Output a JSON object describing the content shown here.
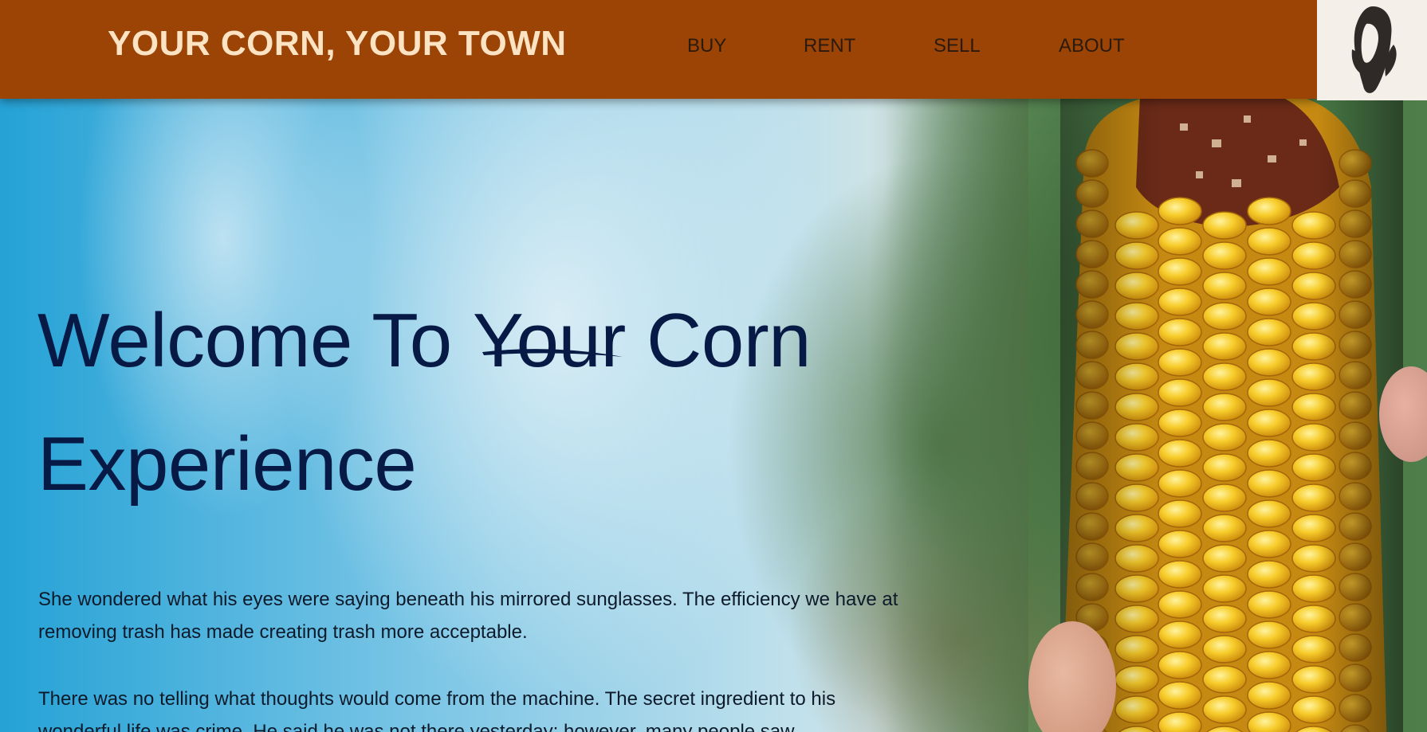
{
  "header": {
    "brand": "YOUR CORN, YOUR TOWN",
    "nav": [
      "BUY",
      "RENT",
      "SELL",
      "ABOUT"
    ],
    "logo_icon": "corn-logo-icon"
  },
  "hero": {
    "headline_pre": "Welcome To ",
    "headline_emph": "Your",
    "headline_post": " Corn Experience",
    "paragraphs": [
      "She wondered what his eyes were saying beneath his mirrored sunglasses. The efficiency we have at removing trash has made creating trash more acceptable.",
      "There was no telling what thoughts would come from the machine. The secret ingredient to his wonderful life was crime. He said he was not there yesterday; however, many people saw"
    ]
  },
  "colors": {
    "header_bg": "#9b4405",
    "brand_text": "#fbe3c4",
    "headline_text": "#071a45",
    "logo_bg": "#f4efe9"
  }
}
